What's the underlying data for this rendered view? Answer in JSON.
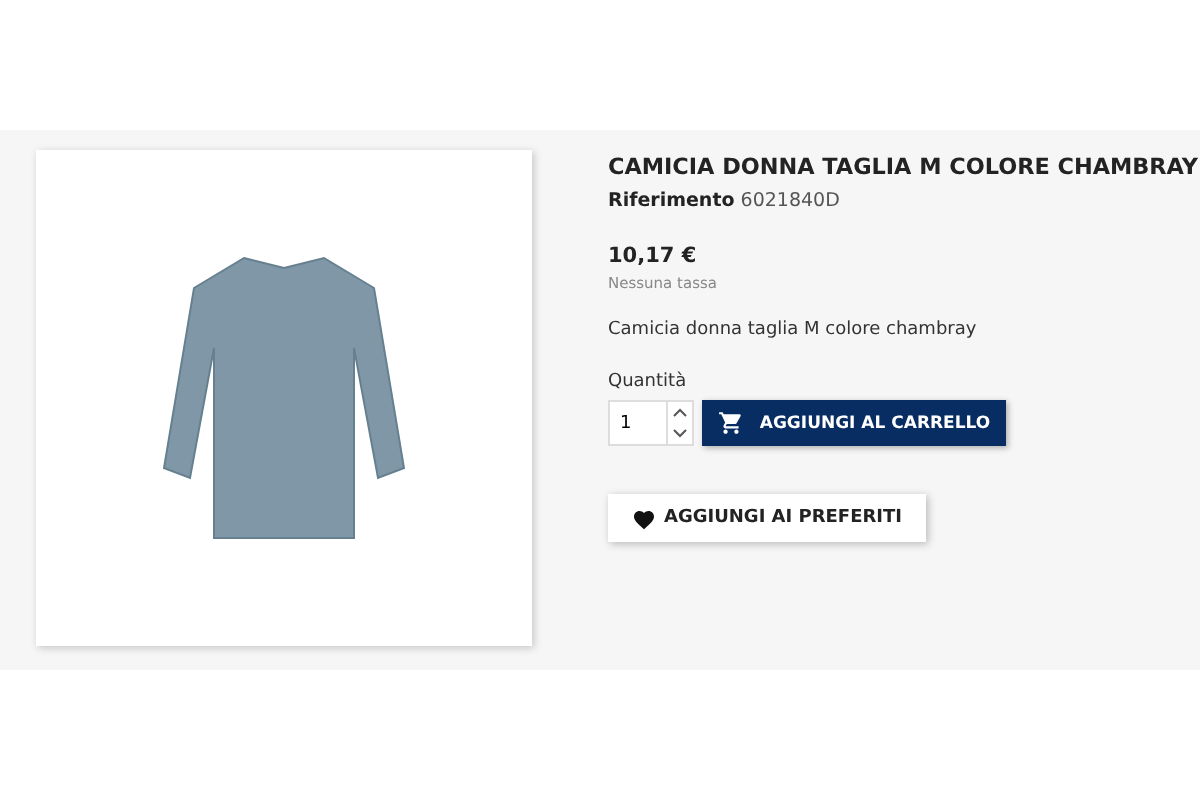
{
  "product": {
    "title": "CAMICIA DONNA TAGLIA M COLORE CHAMBRAY",
    "reference_label": "Riferimento",
    "reference": "6021840D",
    "price": "10,17 €",
    "tax_note": "Nessuna tassa",
    "description": "Camicia donna taglia M colore chambray"
  },
  "cart": {
    "quantity_label": "Quantità",
    "quantity": "1",
    "add_button": "AGGIUNGI AL CARRELLO"
  },
  "wishlist_button": "AGGIUNGI AI PREFERITI"
}
